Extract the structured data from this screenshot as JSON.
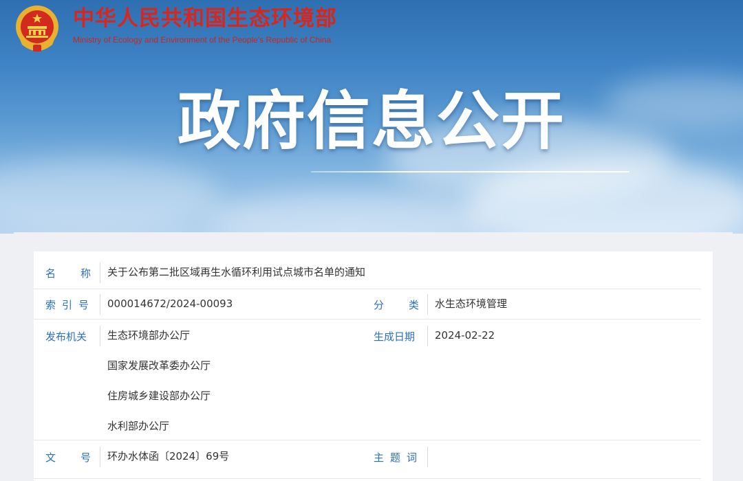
{
  "header": {
    "ministry_name_cn": "中华人民共和国生态环境部",
    "ministry_name_en": "Ministry of Ecology and Environment of the People's Republic of China",
    "emblem_icon": "national-emblem-icon",
    "brand_color": "#d9261c"
  },
  "banner": {
    "title": "政府信息公开"
  },
  "info": {
    "name_label": "名称",
    "name_value": "关于公布第二批区域再生水循环利用试点城市名单的通知",
    "index_label": "索引号",
    "index_value": "000014672/2024-00093",
    "category_label": "分类",
    "category_value": "水生态环境管理",
    "issuer_label": "发布机关",
    "issuers": [
      "生态环境部办公厅",
      "国家发展改革委办公厅",
      "住房城乡建设部办公厅",
      "水利部办公厅"
    ],
    "date_label": "生成日期",
    "date_value": "2024-02-22",
    "doc_number_label": "文号",
    "doc_number_value": "环办水体函〔2024〕69号",
    "keywords_label": "主题词",
    "keywords_value": "",
    "label_color": "#2a6fc0"
  }
}
